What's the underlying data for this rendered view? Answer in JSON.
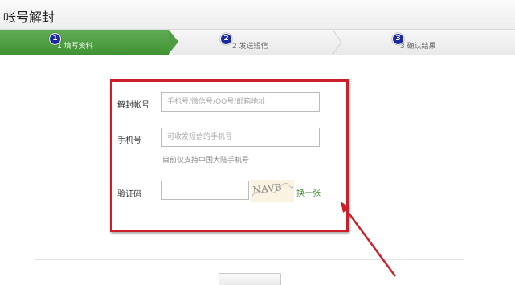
{
  "window": {
    "title": "帐号解封"
  },
  "steps": [
    {
      "number": "1",
      "label": "1 填写资料",
      "state": "active"
    },
    {
      "number": "2",
      "label": "2 发送短信",
      "state": "pending"
    },
    {
      "number": "3",
      "label": "3 确认结果",
      "state": "pending"
    }
  ],
  "form": {
    "account": {
      "label": "解封帐号",
      "placeholder": "手机号/微信号/QQ号/邮箱地址"
    },
    "phone": {
      "label": "手机号",
      "placeholder": "可收发短信的手机号",
      "hint": "目前仅支持中国大陆手机号"
    },
    "captcha": {
      "label": "验证码",
      "value": "",
      "image_text": "NAVB",
      "refresh_label": "换一张"
    }
  },
  "colors": {
    "step_active": "#4e9d43",
    "highlight_box": "#cc1f2a",
    "annotation_arrow": "#cc1f2a",
    "step_badge": "#1a2a9c",
    "link": "#3a8a2a"
  }
}
